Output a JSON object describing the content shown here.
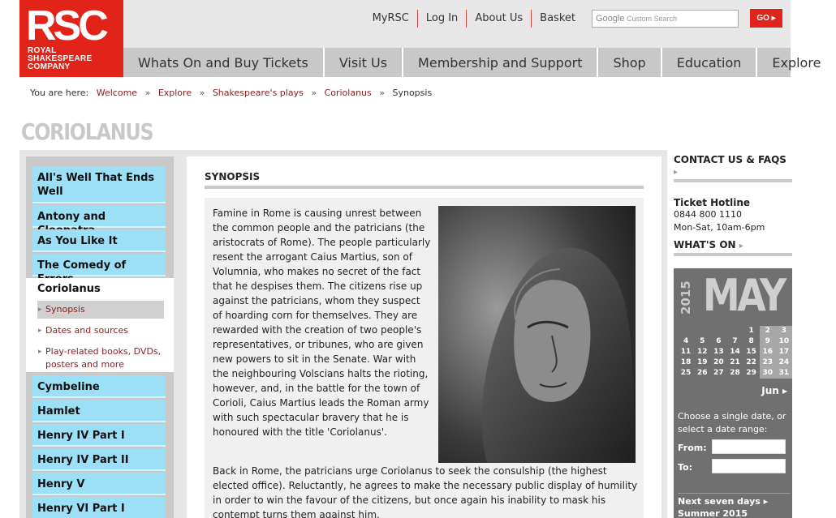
{
  "header": {
    "logo_big": "RSC",
    "logo_lines": [
      "ROYAL",
      "SHAKESPEARE",
      "COMPANY"
    ],
    "util_nav": [
      "MyRSC",
      "Log In",
      "About Us",
      "Basket"
    ],
    "search_placeholder_brand": "Google",
    "search_placeholder_text": "Custom Search",
    "go_label": "GO ▸",
    "main_nav": [
      "Whats On and Buy Tickets",
      "Visit Us",
      "Membership and Support",
      "Shop",
      "Education",
      "Explore"
    ]
  },
  "breadcrumb": {
    "prefix": "You are here:",
    "links": [
      "Welcome",
      "Explore",
      "Shakespeare's plays",
      "Coriolanus"
    ],
    "current": "Synopsis",
    "separator": "»"
  },
  "page_title": "CORIOLANUS",
  "sidebar": {
    "plays_before": [
      "All's Well That Ends Well",
      "Antony and Cleopatra",
      "As You Like It",
      "The Comedy of Errors"
    ],
    "active_play": "Coriolanus",
    "sub_items": [
      "Synopsis",
      "Dates and sources",
      "Play-related books, DVDs, posters and more"
    ],
    "plays_after": [
      "Cymbeline",
      "Hamlet",
      "Henry IV Part I",
      "Henry IV Part II",
      "Henry V",
      "Henry VI Part I"
    ]
  },
  "main": {
    "section_title": "SYNOPSIS",
    "paragraph1": "Famine in Rome is causing unrest between the common people and the patricians (the aristocrats of Rome). The people particularly resent the arrogant Caius Martius, son of Volumnia, who makes no secret of the fact that he despises them. The citizens rise up against the patricians, whom they suspect of hoarding corn for themselves. They are rewarded with the creation of two people's representatives, or tribunes, who are given new powers to sit in the Senate. War with the neighbouring Volscians halts the rioting, however, and, in the battle for the town of Corioli, Caius Martius leads the Roman army with such spectacular bravery that he is honoured with the title 'Coriolanus'.",
    "paragraph2": "Back in Rome, the patricians urge Coriolanus to seek the consulship (the highest elected office). Reluctantly, he agrees to make the necessary public display of humility in order to win the favour of the citizens, but once again his inability to mask his contempt turns them against him."
  },
  "right": {
    "contact_heading": "CONTACT US & FAQS",
    "hotline_title": "Ticket Hotline",
    "hotline_number": "0844 800 1110",
    "hotline_hours": "Mon-Sat, 10am-6pm",
    "whatson_heading": "WHAT'S ON",
    "calendar": {
      "year": "2015",
      "month": "MAY",
      "weeks": [
        [
          "",
          "",
          "",
          "",
          "1",
          "2",
          "3"
        ],
        [
          "4",
          "5",
          "6",
          "7",
          "8",
          "9",
          "10"
        ],
        [
          "11",
          "12",
          "13",
          "14",
          "15",
          "16",
          "17"
        ],
        [
          "18",
          "19",
          "20",
          "21",
          "22",
          "23",
          "24"
        ],
        [
          "25",
          "26",
          "27",
          "28",
          "29",
          "30",
          "31"
        ]
      ],
      "next_month": "Jun ▸",
      "choose_text": "Choose a single date, or select a date range:",
      "from_label": "From:",
      "to_label": "To:",
      "link1": "Next seven days ▸",
      "link2": "Summer 2015"
    }
  },
  "colors": {
    "brand_red": "#e2231a",
    "link_red": "#8b1d1d",
    "play_blue": "#9be0f6",
    "calendar_grey": "#707070"
  }
}
